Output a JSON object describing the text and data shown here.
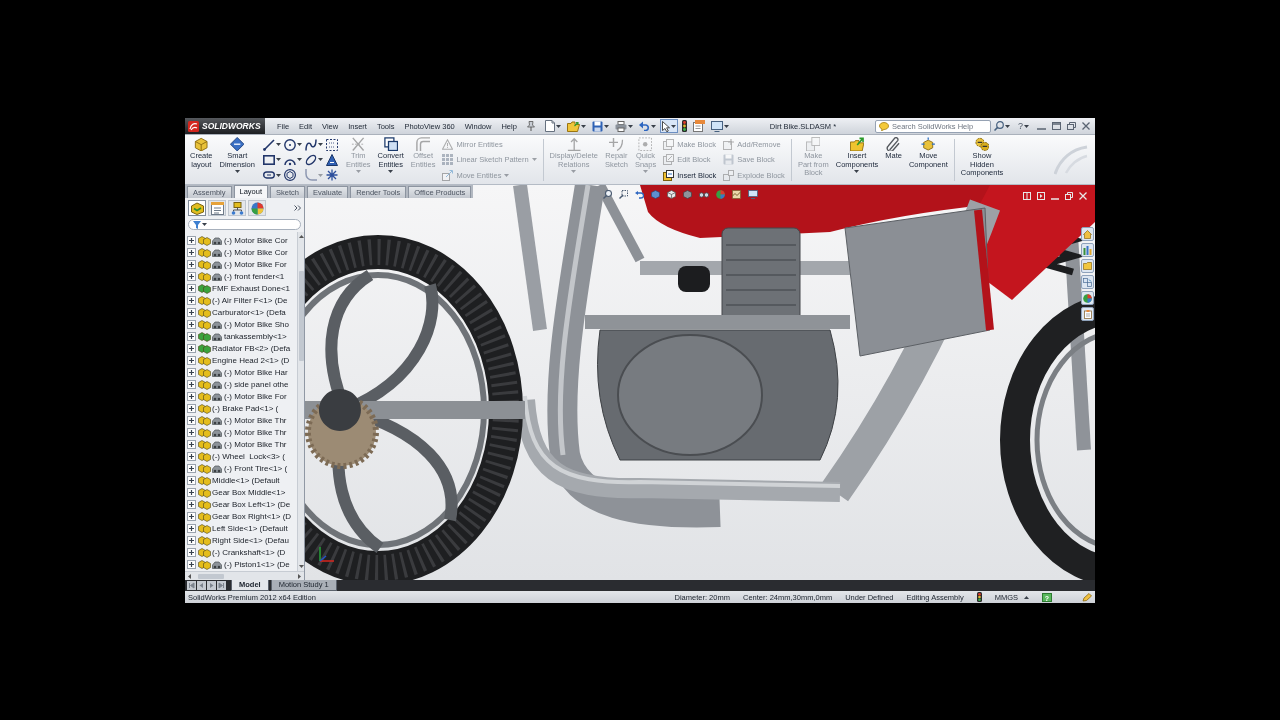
{
  "window": {
    "logo": "SOLIDWORKS",
    "title": "Dirt Bike.SLDASM *",
    "help": "?"
  },
  "menu": [
    "File",
    "Edit",
    "View",
    "Insert",
    "Tools",
    "PhotoView 360",
    "Window",
    "Help"
  ],
  "quick_access": [
    {
      "dropdown": true,
      "selected": false
    },
    {
      "dropdown": true,
      "selected": false
    },
    {
      "dropdown": true,
      "selected": false
    },
    {
      "dropdown": true,
      "selected": false
    },
    {
      "dropdown": true,
      "selected": false
    },
    {
      "dropdown": true,
      "selected": true
    },
    {
      "dropdown": false,
      "selected": false
    },
    {
      "dropdown": false,
      "selected": false
    },
    {
      "dropdown": true,
      "selected": false
    }
  ],
  "search": {
    "placeholder": "Search SolidWorks Help"
  },
  "ribbon": {
    "sections": [
      {
        "groups": [
          {
            "kind": "large",
            "items": [
              {
                "label": "Create\nlayout",
                "disabled": false,
                "dropdown": false
              },
              {
                "label": "Smart\nDimension",
                "disabled": false,
                "dropdown": true
              }
            ]
          },
          {
            "kind": "sketch",
            "items": [
              {
                "disabled": false,
                "dropdown": true
              },
              {
                "disabled": false,
                "dropdown": true
              },
              {
                "disabled": false,
                "dropdown": true
              },
              {
                "disabled": false,
                "dropdown": false
              },
              {
                "disabled": false,
                "dropdown": true
              },
              {
                "disabled": false,
                "dropdown": true
              },
              {
                "disabled": false,
                "dropdown": true
              },
              {
                "disabled": false,
                "dropdown": false
              },
              {
                "disabled": false,
                "dropdown": true
              },
              {
                "disabled": false,
                "dropdown": false
              },
              {
                "disabled": true,
                "dropdown": true
              },
              {
                "disabled": false,
                "dropdown": false
              }
            ]
          },
          {
            "kind": "large",
            "items": [
              {
                "label": "Trim\nEntities",
                "disabled": true,
                "dropdown": true
              },
              {
                "label": "Convert\nEntities",
                "disabled": false,
                "dropdown": true
              },
              {
                "label": "Offset\nEntities",
                "disabled": true,
                "dropdown": false
              }
            ]
          },
          {
            "kind": "small",
            "items": [
              {
                "label": "Mirror Entities",
                "disabled": true,
                "dropdown": false
              },
              {
                "label": "Linear Sketch Pattern",
                "disabled": true,
                "dropdown": true
              },
              {
                "label": "Move Entities",
                "disabled": true,
                "dropdown": true
              }
            ]
          }
        ]
      },
      {
        "groups": [
          {
            "kind": "large",
            "items": [
              {
                "label": "Display/Delete\nRelations",
                "disabled": true,
                "dropdown": true
              },
              {
                "label": "Repair\nSketch",
                "disabled": true,
                "dropdown": false
              },
              {
                "label": "Quick\nSnaps",
                "disabled": true,
                "dropdown": true
              }
            ]
          },
          {
            "kind": "small",
            "items": [
              {
                "label": "Make Block",
                "disabled": true,
                "dropdown": false
              },
              {
                "label": "Edit Block",
                "disabled": true,
                "dropdown": false
              },
              {
                "label": "Insert Block",
                "disabled": false,
                "dropdown": false
              }
            ]
          },
          {
            "kind": "small",
            "items": [
              {
                "label": "Add/Remove",
                "disabled": true,
                "dropdown": false
              },
              {
                "label": "Save Block",
                "disabled": true,
                "dropdown": false
              },
              {
                "label": "Explode Block",
                "disabled": true,
                "dropdown": false
              }
            ]
          }
        ]
      },
      {
        "groups": [
          {
            "kind": "large",
            "items": [
              {
                "label": "Make\nPart from\nBlock",
                "disabled": true,
                "dropdown": false
              },
              {
                "label": "Insert\nComponents",
                "disabled": false,
                "dropdown": true
              },
              {
                "label": "Mate",
                "disabled": false,
                "dropdown": false
              },
              {
                "label": "Move\nComponent",
                "disabled": false,
                "dropdown": false
              }
            ]
          }
        ]
      },
      {
        "groups": [
          {
            "kind": "large",
            "items": [
              {
                "label": "Show\nHidden\nComponents",
                "disabled": false,
                "dropdown": false
              }
            ]
          }
        ]
      }
    ]
  },
  "command_tabs": [
    {
      "label": "Assembly",
      "selected": false
    },
    {
      "label": "Layout",
      "selected": true
    },
    {
      "label": "Sketch",
      "selected": false
    },
    {
      "label": "Evaluate",
      "selected": false
    },
    {
      "label": "Render Tools",
      "selected": false
    },
    {
      "label": "Office Products",
      "selected": false
    }
  ],
  "feature_manager": {
    "tabs": [
      {
        "selected": true
      },
      {
        "selected": false
      },
      {
        "selected": false
      },
      {
        "selected": false
      }
    ],
    "tree": [
      {
        "label": "(-) Motor Bike Cor",
        "color": "#e4bd1c",
        "state_icon": true,
        "expanded": false
      },
      {
        "label": "(-) Motor Bike Cor",
        "color": "#e4bd1c",
        "state_icon": true,
        "expanded": false
      },
      {
        "label": "(-) Motor Bike For",
        "color": "#e4bd1c",
        "state_icon": true,
        "expanded": false
      },
      {
        "label": "(-) front fender<1",
        "color": "#e4bd1c",
        "state_icon": true,
        "expanded": false
      },
      {
        "label": "FMF Exhaust Done<1",
        "color": "#3aa33c",
        "state_icon": false,
        "expanded": false
      },
      {
        "label": "(-) Air Filter F<1> (De",
        "color": "#e4bd1c",
        "state_icon": false,
        "expanded": false
      },
      {
        "label": "Carburator<1> (Defa",
        "color": "#e4bd1c",
        "state_icon": false,
        "expanded": false
      },
      {
        "label": "(-) Motor Bike Sho",
        "color": "#e4bd1c",
        "state_icon": true,
        "expanded": false
      },
      {
        "label": "tankassembly<1>",
        "color": "#3aa33c",
        "state_icon": true,
        "expanded": false
      },
      {
        "label": "Radiator FB<2> (Defa",
        "color": "#3aa33c",
        "state_icon": false,
        "expanded": false
      },
      {
        "label": "Engine Head 2<1> (D",
        "color": "#e4bd1c",
        "state_icon": false,
        "expanded": false
      },
      {
        "label": "(-) Motor Bike Har",
        "color": "#e4bd1c",
        "state_icon": true,
        "expanded": false
      },
      {
        "label": "(-) side panel othe",
        "color": "#e4bd1c",
        "state_icon": true,
        "expanded": false
      },
      {
        "label": "(-) Motor Bike For",
        "color": "#e4bd1c",
        "state_icon": true,
        "expanded": false
      },
      {
        "label": "(-) Brake Pad<1> (",
        "color": "#e4bd1c",
        "state_icon": false,
        "expanded": false
      },
      {
        "label": "(-) Motor Bike Thr",
        "color": "#e4bd1c",
        "state_icon": true,
        "expanded": false
      },
      {
        "label": "(-) Motor Bike Thr",
        "color": "#e4bd1c",
        "state_icon": true,
        "expanded": false
      },
      {
        "label": "(-) Motor Bike Thr",
        "color": "#e4bd1c",
        "state_icon": true,
        "expanded": false
      },
      {
        "label": "(-) Wheel  Lock<3> (",
        "color": "#e4bd1c",
        "state_icon": false,
        "expanded": false
      },
      {
        "label": "(-) Front Tire<1> (",
        "color": "#e4bd1c",
        "state_icon": true,
        "expanded": false
      },
      {
        "label": "Middle<1> (Default",
        "color": "#e4bd1c",
        "state_icon": false,
        "expanded": false
      },
      {
        "label": "Gear Box Middle<1>",
        "color": "#e4bd1c",
        "state_icon": false,
        "expanded": false
      },
      {
        "label": "Gear Box Left<1> (De",
        "color": "#e4bd1c",
        "state_icon": false,
        "expanded": false
      },
      {
        "label": "Gear Box Right<1> (D",
        "color": "#e4bd1c",
        "state_icon": false,
        "expanded": false
      },
      {
        "label": "Left Side<1> (Default",
        "color": "#e4bd1c",
        "state_icon": false,
        "expanded": false
      },
      {
        "label": "Right Side<1> (Defau",
        "color": "#e4bd1c",
        "state_icon": false,
        "expanded": false
      },
      {
        "label": "(-) Crankshaft<1> (D",
        "color": "#e4bd1c",
        "state_icon": false,
        "expanded": false
      },
      {
        "label": "(-) Piston1<1> (De",
        "color": "#e4bd1c",
        "state_icon": true,
        "expanded": false
      }
    ]
  },
  "bottom_tabs": [
    {
      "label": "Model",
      "selected": true
    },
    {
      "label": "Motion Study 1",
      "selected": false
    }
  ],
  "status_bar": {
    "product": "SolidWorks Premium 2012 x64 Edition",
    "fields": [
      "Diameter: 20mm",
      "Center: 24mm,30mm,0mm",
      "Under Defined",
      "Editing Assembly"
    ],
    "units": "MMGS",
    "help": "?"
  }
}
